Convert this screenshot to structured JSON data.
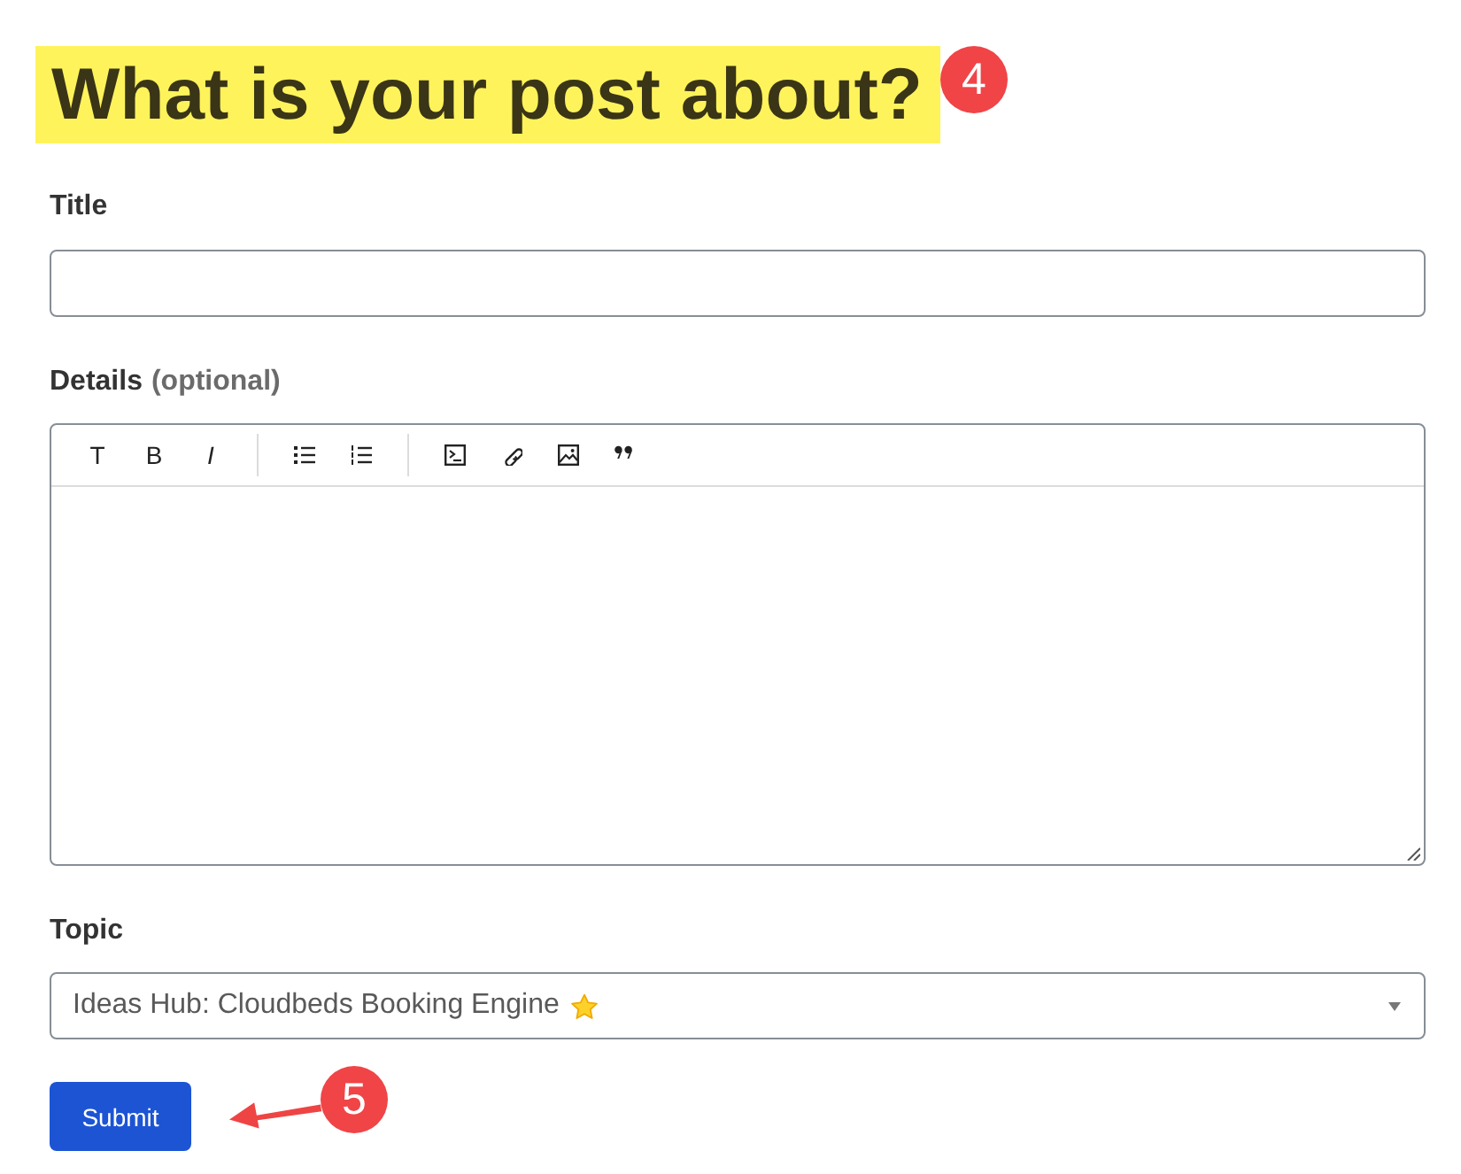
{
  "heading": {
    "text": "What is your post about?",
    "highlighted": true,
    "badge": "4"
  },
  "fields": [
    {
      "kind": "text",
      "label": "Title"
    },
    {
      "kind": "editor",
      "label": "Details",
      "hint": "(optional)",
      "toolbar": [
        {
          "tools": [
            {
              "kind": "heading",
              "label": "T"
            },
            {
              "kind": "bold",
              "label": "B"
            },
            {
              "kind": "italic",
              "label": "I"
            }
          ]
        },
        {
          "tools": [
            {
              "kind": "bullets"
            },
            {
              "kind": "numbers"
            }
          ]
        },
        {
          "tools": [
            {
              "kind": "code"
            },
            {
              "kind": "link"
            },
            {
              "kind": "image"
            },
            {
              "kind": "quote"
            }
          ]
        }
      ]
    },
    {
      "kind": "select",
      "label": "Topic",
      "value": "Ideas Hub: Cloudbeds Booking Engine",
      "starred": true
    }
  ],
  "submit": {
    "label": "Submit",
    "badge": "5"
  }
}
